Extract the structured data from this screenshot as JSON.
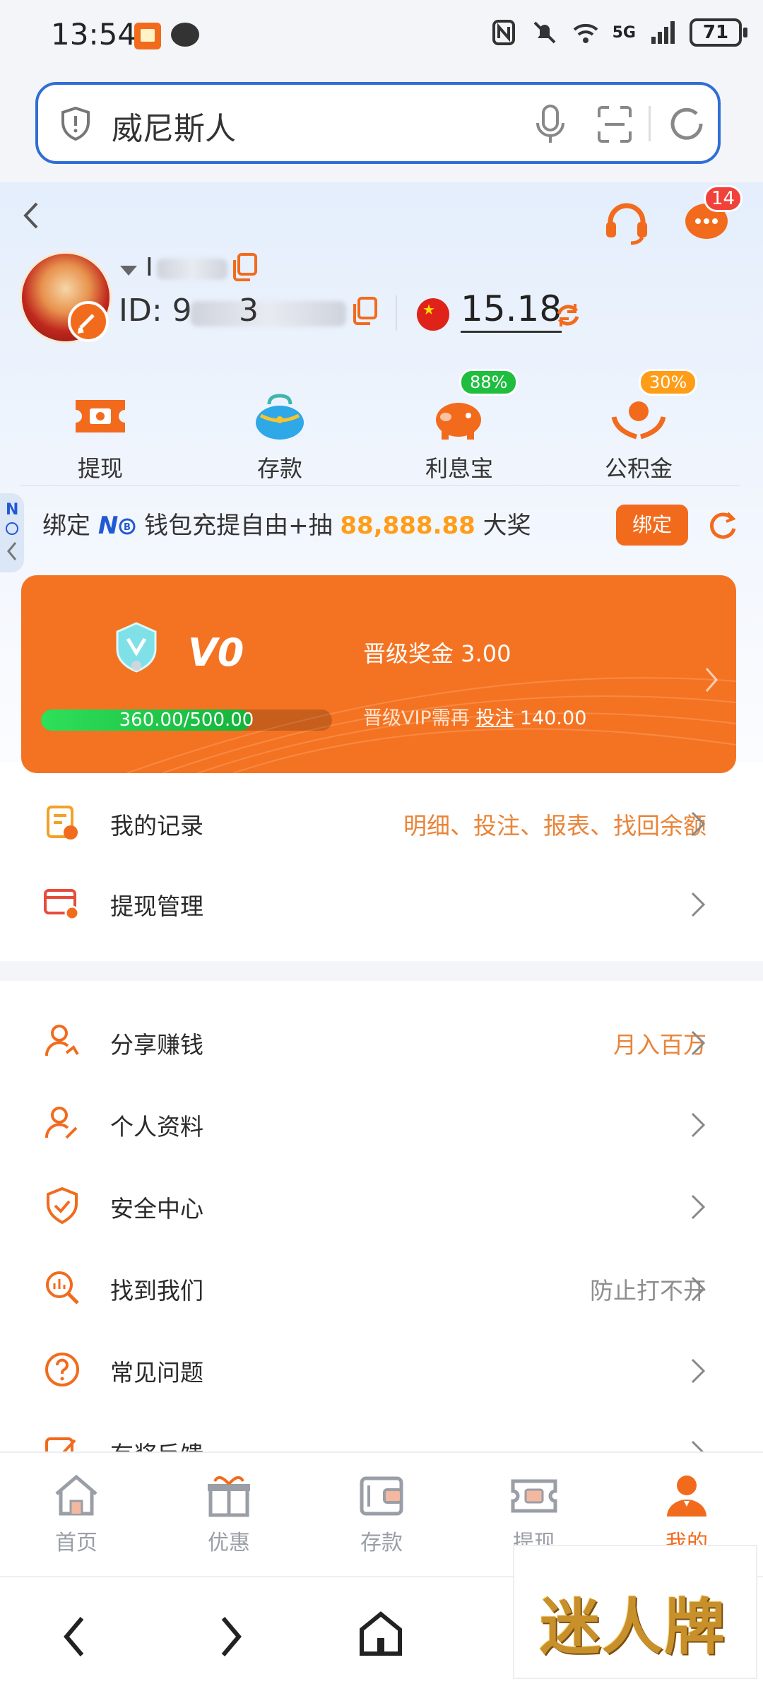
{
  "status_bar": {
    "time": "13:54",
    "network": "5G",
    "battery": "71"
  },
  "browser": {
    "search_query": "威尼斯人"
  },
  "header": {
    "chat_badge_count": "14"
  },
  "user": {
    "name_prefix": "I",
    "id_label": "ID: 9",
    "id_partial": "3",
    "balance": "15.18"
  },
  "quick_actions": [
    {
      "label": "提现",
      "icon": "withdraw-ticket-icon"
    },
    {
      "label": "存款",
      "icon": "wallet-purse-icon"
    },
    {
      "label": "利息宝",
      "icon": "piggy-bank-icon",
      "tag": "88%",
      "tag_color": "#1fbe3f"
    },
    {
      "label": "公积金",
      "icon": "hands-coin-icon",
      "tag": "30%",
      "tag_color": "#ff9d18"
    }
  ],
  "promo": {
    "text_before": "绑定 ",
    "brand": "N",
    "text_mid": " 钱包充提自由+抽 ",
    "amount": "88,888.88",
    "text_after": " 大奖",
    "bind_label": "绑定"
  },
  "vip": {
    "level": "V0",
    "progress_text": "360.00/500.00",
    "progress_fraction": 0.72,
    "bonus_text": "晋级奖金 3.00",
    "need_prefix": "晋级VIP需再 ",
    "need_link": "投注",
    "need_amount": " 140.00"
  },
  "menu": [
    {
      "label": "我的记录",
      "hint": "明细、投注、报表、找回余额",
      "hint_style": "orange"
    },
    {
      "label": "提现管理",
      "hint": ""
    },
    {
      "label": "分享赚钱",
      "hint": "月入百万",
      "hint_style": "orange"
    },
    {
      "label": "个人资料",
      "hint": ""
    },
    {
      "label": "安全中心",
      "hint": ""
    },
    {
      "label": "找到我们",
      "hint": "防止打不开",
      "hint_style": "gray"
    },
    {
      "label": "常见问题",
      "hint": ""
    },
    {
      "label": "有奖反馈",
      "hint": ""
    }
  ],
  "tabs": [
    {
      "label": "首页",
      "active": false
    },
    {
      "label": "优惠",
      "active": false
    },
    {
      "label": "存款",
      "active": false
    },
    {
      "label": "提现",
      "active": false
    },
    {
      "label": "我的",
      "active": true
    }
  ],
  "watermark": "迷人牌",
  "colors": {
    "accent": "#f26b1d",
    "browser_border": "#2f6ed6",
    "progress_green": "#2ee05a",
    "promo_amount": "#ff9d18"
  }
}
